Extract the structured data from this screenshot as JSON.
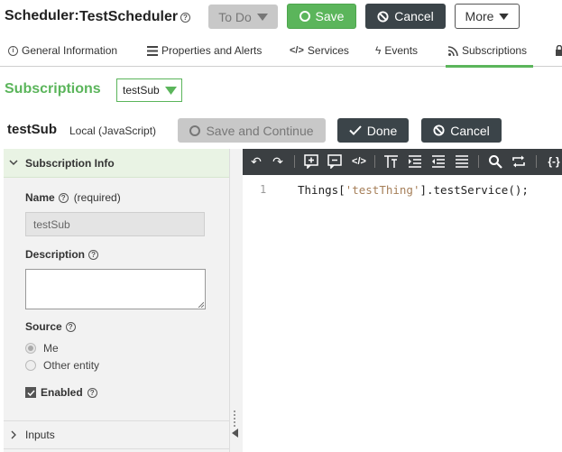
{
  "header": {
    "prefix": "Scheduler:",
    "name": "TestScheduler",
    "todo_label": "To Do",
    "save_label": "Save",
    "cancel_label": "Cancel",
    "more_label": "More"
  },
  "tabs": [
    {
      "label": "General Information"
    },
    {
      "label": "Properties and Alerts"
    },
    {
      "label": "Services"
    },
    {
      "label": "Events"
    },
    {
      "label": "Subscriptions"
    }
  ],
  "subscriptions": {
    "title": "Subscriptions",
    "selected": "testSub"
  },
  "sub_header": {
    "name": "testSub",
    "type": "Local (JavaScript)",
    "save_continue_label": "Save and Continue",
    "done_label": "Done",
    "cancel_label": "Cancel"
  },
  "panel": {
    "section_title": "Subscription Info",
    "name_label": "Name",
    "name_required": "(required)",
    "name_value": "testSub",
    "description_label": "Description",
    "description_value": "",
    "source_label": "Source",
    "source_options": [
      "Me",
      "Other entity"
    ],
    "enabled_label": "Enabled",
    "inputs_label": "Inputs"
  },
  "editor": {
    "line_number": "1",
    "code_prefix": "Things[",
    "code_string": "'testThing'",
    "code_suffix": "].testService();"
  },
  "colors": {
    "accent_green": "#5bb55b",
    "dark_button": "#3b4449",
    "toolbar_bg": "#3b3f42",
    "panel_bg": "#f2f2f2",
    "section_bg": "#e9f3e4"
  }
}
